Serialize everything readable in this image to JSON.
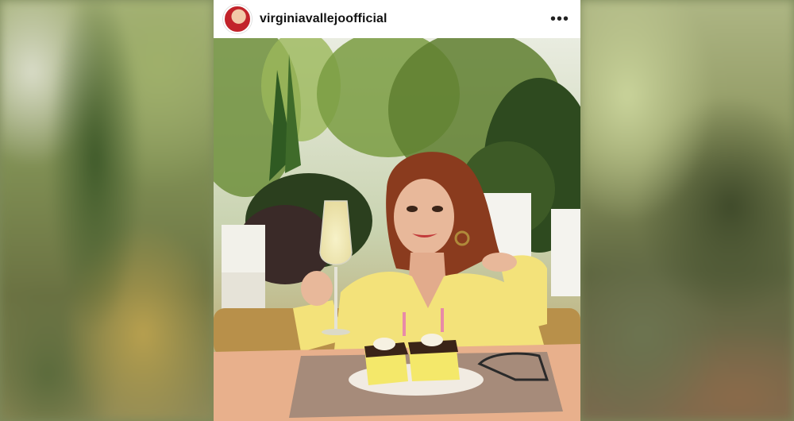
{
  "post": {
    "username": "virginiavallejoofficial",
    "more_icon": "more-horizontal-icon",
    "more_glyph": "•••",
    "avatar_icon": "profile-avatar"
  },
  "photo": {
    "description_icon": "photo",
    "colors": {
      "foliage_dark": "#2f4a1f",
      "foliage_light": "#8fb04a",
      "dress": "#f3e27a",
      "hair": "#8a3b1e",
      "skin": "#e8b89a",
      "lips": "#c23a3a",
      "tablecloth": "#e8b08c",
      "cake": "#f4e86a"
    }
  }
}
